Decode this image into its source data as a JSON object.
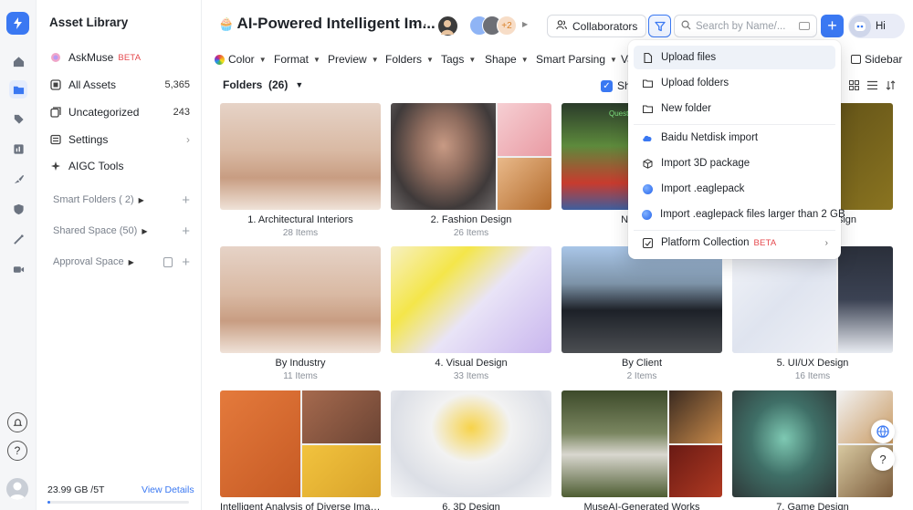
{
  "sidebar": {
    "title": "Asset Library",
    "items": [
      {
        "label": "AskMuse",
        "badge": "BETA",
        "count": ""
      },
      {
        "label": "All Assets",
        "count": "5,365"
      },
      {
        "label": "Uncategorized",
        "count": "243"
      },
      {
        "label": "Settings"
      },
      {
        "label": "AIGC Tools"
      }
    ],
    "sections": [
      {
        "label": "Smart Folders ( 2)"
      },
      {
        "label": "Shared Space (50)"
      },
      {
        "label": "Approval Space"
      }
    ],
    "storage": "23.99 GB /5T",
    "view_details": "View Details",
    "storage_fraction": 0.005
  },
  "header": {
    "emoji": "🧁",
    "title": "AI-Powered Intelligent Im...",
    "more": "···",
    "extra_avatars": "+2",
    "collaborators_label": "Collaborators",
    "search_placeholder": "Search by Name/...",
    "hi_label": "Hi"
  },
  "filterbar": {
    "items": [
      "Color",
      "Format",
      "Preview",
      "Folders",
      "Tags",
      "Shape",
      "Smart Parsing",
      "Va"
    ],
    "sidebar_label": "Sidebar"
  },
  "folders_header": "Folders  (26)",
  "show_label": "Sh",
  "folders": [
    {
      "name": "1. Architectural Interiors",
      "count": "28 Items"
    },
    {
      "name": "2. Fashion Design",
      "count": "26 Items"
    },
    {
      "name": "NASA | S",
      "count": "2"
    },
    {
      "name": "sign",
      "count": ""
    },
    {
      "name": "By Industry",
      "count": "11 Items"
    },
    {
      "name": "4. Visual Design",
      "count": "33 Items"
    },
    {
      "name": "By Client",
      "count": "2 Items"
    },
    {
      "name": "5. UI/UX Design",
      "count": "16 Items"
    },
    {
      "name": "Intelligent Analysis of Diverse Imag...",
      "count": ""
    },
    {
      "name": "6. 3D Design",
      "count": ""
    },
    {
      "name": "MuseAI-Generated Works",
      "count": ""
    },
    {
      "name": "7. Game Design",
      "count": ""
    }
  ],
  "thumb_text": {
    "quest": "Quest"
  },
  "menu": {
    "items": [
      {
        "label": "Upload files"
      },
      {
        "label": "Upload folders"
      },
      {
        "label": "New folder"
      },
      {
        "label": "Baidu Netdisk import"
      },
      {
        "label": "Import 3D package"
      },
      {
        "label": "Import .eaglepack"
      },
      {
        "label": "Import .eaglepack files larger than 2 GB"
      },
      {
        "label": "Platform Collection",
        "badge": "BETA"
      }
    ]
  },
  "colors": {
    "accent": "#3a78f2",
    "beta": "#e5484d"
  }
}
